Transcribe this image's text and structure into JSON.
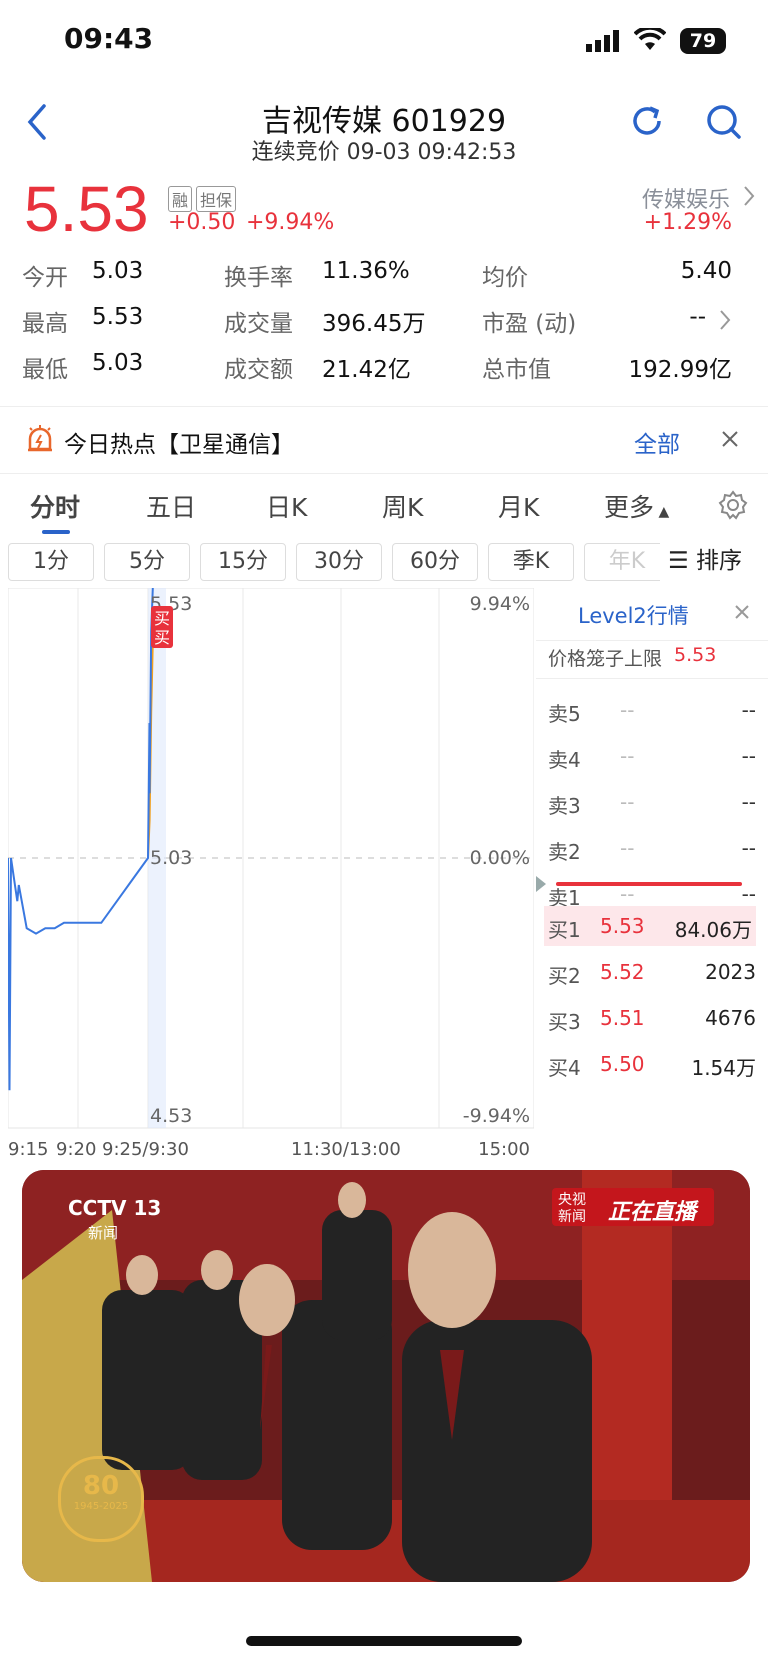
{
  "status": {
    "time": "09:43",
    "battery": "79"
  },
  "header": {
    "title": "吉视传媒 601929",
    "subtitle": "连续竞价 09-03 09:42:53"
  },
  "quote": {
    "price": "5.53",
    "tags": [
      "融",
      "担保"
    ],
    "change": "+0.50",
    "change_pct": "+9.94%",
    "sector_name": "传媒娱乐",
    "sector_change": "+1.29%",
    "stats": [
      [
        {
          "label": "今开",
          "value": "5.03"
        },
        {
          "label": "换手率",
          "value": "11.36%"
        },
        {
          "label": "均价",
          "value": "5.40"
        }
      ],
      [
        {
          "label": "最高",
          "value": "5.53"
        },
        {
          "label": "成交量",
          "value": "396.45万"
        },
        {
          "label": "市盈 (动)",
          "value": "--"
        }
      ],
      [
        {
          "label": "最低",
          "value": "5.03"
        },
        {
          "label": "成交额",
          "value": "21.42亿"
        },
        {
          "label": "总市值",
          "value": "192.99亿"
        }
      ]
    ]
  },
  "hot": {
    "text": "今日热点【卫星通信】",
    "all": "全部"
  },
  "tabs": [
    "分时",
    "五日",
    "日K",
    "周K",
    "月K",
    "更多"
  ],
  "subtabs": [
    "1分",
    "5分",
    "15分",
    "30分",
    "60分",
    "季K",
    "年K"
  ],
  "sort_label": "排序",
  "chart_data": {
    "type": "line",
    "x_ticks": [
      "9:15",
      "9:20",
      "9:25/9:30",
      "11:30/13:00",
      "15:00"
    ],
    "y_left_ticks": [
      "5.53",
      "5.03",
      "4.53"
    ],
    "y_right_ticks": [
      "9.94%",
      "0.00%",
      "-9.94%"
    ],
    "ylim": [
      4.53,
      5.53
    ],
    "buy_marker": "买",
    "price_series": [
      {
        "t": "9:15",
        "p": 5.03
      },
      {
        "t": "9:15",
        "p": 4.6
      },
      {
        "t": "9:15",
        "p": 5.03
      },
      {
        "t": "9:16",
        "p": 4.95
      },
      {
        "t": "9:16",
        "p": 4.98
      },
      {
        "t": "9:17",
        "p": 4.9
      },
      {
        "t": "9:18",
        "p": 4.89
      },
      {
        "t": "9:19",
        "p": 4.9
      },
      {
        "t": "9:20",
        "p": 4.9
      },
      {
        "t": "9:21",
        "p": 4.91
      },
      {
        "t": "9:25",
        "p": 4.91
      },
      {
        "t": "9:30",
        "p": 5.03
      },
      {
        "t": "9:30",
        "p": 5.28
      },
      {
        "t": "9:31",
        "p": 5.15
      },
      {
        "t": "9:32",
        "p": 5.45
      },
      {
        "t": "9:33",
        "p": 5.53
      }
    ],
    "avg_series": [
      {
        "t": "9:30",
        "p": 5.03
      },
      {
        "t": "9:31",
        "p": 5.1
      },
      {
        "t": "9:32",
        "p": 5.3
      },
      {
        "t": "9:33",
        "p": 5.43
      },
      {
        "t": "9:34",
        "p": 5.45
      }
    ]
  },
  "level2": {
    "title": "Level2行情",
    "cage_label": "价格笼子上限",
    "cage_value": "5.53",
    "asks": [
      {
        "label": "卖5",
        "price": "--",
        "vol": "--"
      },
      {
        "label": "卖4",
        "price": "--",
        "vol": "--"
      },
      {
        "label": "卖3",
        "price": "--",
        "vol": "--"
      },
      {
        "label": "卖2",
        "price": "--",
        "vol": "--"
      },
      {
        "label": "卖1",
        "price": "--",
        "vol": "--"
      }
    ],
    "bids": [
      {
        "label": "买1",
        "price": "5.53",
        "vol": "84.06万"
      },
      {
        "label": "买2",
        "price": "5.52",
        "vol": "2023"
      },
      {
        "label": "买3",
        "price": "5.51",
        "vol": "4676"
      },
      {
        "label": "买4",
        "price": "5.50",
        "vol": "1.54万"
      }
    ]
  },
  "video": {
    "channel": "CCTV 13",
    "channel_sub": "新闻",
    "live_badge_top": "央视",
    "live_badge_bottom": "新闻",
    "live_label": "正在直播",
    "logo_number": "80",
    "logo_years": "1945-2025"
  }
}
